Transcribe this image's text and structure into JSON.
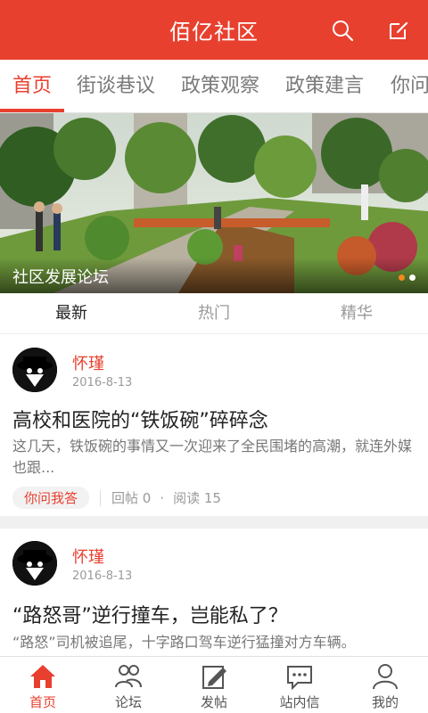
{
  "header": {
    "title": "佰亿社区",
    "search_icon": "search-icon",
    "edit_icon": "edit-icon"
  },
  "tabs": [
    {
      "label": "首页"
    },
    {
      "label": "街谈巷议"
    },
    {
      "label": "政策观察"
    },
    {
      "label": "政策建言"
    },
    {
      "label": "你问"
    }
  ],
  "banner": {
    "caption": "社区发展论坛",
    "page_count": 2,
    "current_page": 1
  },
  "subtabs": [
    {
      "label": "最新"
    },
    {
      "label": "热门"
    },
    {
      "label": "精华"
    }
  ],
  "posts": [
    {
      "author": "怀瑾",
      "date": "2016-8-13",
      "title": "高校和医院的“铁饭碗”碎碎念",
      "excerpt": "这几天，铁饭碗的事情又一次迎来了全民围堵的高潮，就连外媒也跟...",
      "tag": "你问我答",
      "replies": "回帖 0",
      "dot": "·",
      "reads": "阅读 15"
    },
    {
      "author": "怀瑾",
      "date": "2016-8-13",
      "title": "“路怒哥”逆行撞车，岂能私了？",
      "excerpt": "“路怒”司机被追尾，十字路口驾车逆行猛撞对方车辆。"
    }
  ],
  "bottom_nav": [
    {
      "label": "首页",
      "icon": "home-icon"
    },
    {
      "label": "论坛",
      "icon": "forum-icon"
    },
    {
      "label": "发帖",
      "icon": "compose-icon"
    },
    {
      "label": "站内信",
      "icon": "message-icon"
    },
    {
      "label": "我的",
      "icon": "user-icon"
    }
  ],
  "colors": {
    "accent": "#e8402f",
    "banner_dot_active": "#f08a1c"
  }
}
